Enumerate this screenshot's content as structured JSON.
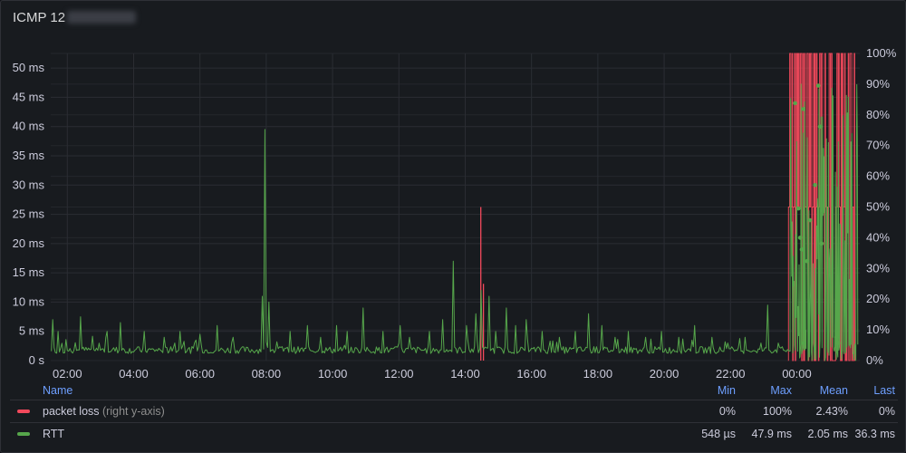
{
  "panel": {
    "title": "ICMP 12"
  },
  "chart_data": {
    "type": "line",
    "x_ticks": [
      "02:00",
      "04:00",
      "06:00",
      "08:00",
      "10:00",
      "12:00",
      "14:00",
      "16:00",
      "18:00",
      "20:00",
      "22:00",
      "00:00"
    ],
    "x_range_hours": [
      1.5,
      25.9
    ],
    "y_left": {
      "ticks": [
        "0 s",
        "5 ms",
        "10 ms",
        "15 ms",
        "20 ms",
        "25 ms",
        "30 ms",
        "35 ms",
        "40 ms",
        "45 ms",
        "50 ms"
      ],
      "ylim_ms": [
        0,
        52.5
      ]
    },
    "y_right": {
      "ticks": [
        "0%",
        "10%",
        "20%",
        "30%",
        "40%",
        "50%",
        "60%",
        "70%",
        "80%",
        "90%",
        "100%"
      ],
      "ylim_pct": [
        0,
        100
      ]
    },
    "grid": true,
    "series": [
      {
        "name": "packet loss",
        "axis": "right",
        "color": "#f2495c",
        "spikes_pct": [
          [
            14.47,
            50
          ],
          [
            14.55,
            25
          ]
        ],
        "dense_region_hours": [
          23.75,
          25.75
        ],
        "dense_levels_pct": [
          0,
          50,
          100
        ]
      },
      {
        "name": "RTT",
        "axis": "left",
        "color": "#56a64b",
        "baseline_ms": 1.2,
        "spikes_ms": [
          [
            1.55,
            7
          ],
          [
            1.72,
            5
          ],
          [
            2.4,
            7.5
          ],
          [
            3.2,
            5
          ],
          [
            3.6,
            6.5
          ],
          [
            4.3,
            5
          ],
          [
            4.9,
            4
          ],
          [
            5.4,
            5
          ],
          [
            6.0,
            4.5
          ],
          [
            6.5,
            6
          ],
          [
            7.0,
            4
          ],
          [
            7.85,
            11
          ],
          [
            7.95,
            39.5
          ],
          [
            8.05,
            10
          ],
          [
            8.7,
            5
          ],
          [
            9.2,
            6
          ],
          [
            9.6,
            4
          ],
          [
            10.1,
            6
          ],
          [
            10.4,
            5
          ],
          [
            10.9,
            9
          ],
          [
            11.5,
            5
          ],
          [
            12.0,
            6
          ],
          [
            12.3,
            4
          ],
          [
            12.9,
            5
          ],
          [
            13.3,
            7
          ],
          [
            13.6,
            17
          ],
          [
            14.0,
            6
          ],
          [
            14.3,
            8
          ],
          [
            14.45,
            12
          ],
          [
            14.7,
            11
          ],
          [
            14.9,
            5
          ],
          [
            15.2,
            9
          ],
          [
            15.5,
            6
          ],
          [
            15.8,
            7
          ],
          [
            16.3,
            5
          ],
          [
            16.8,
            4
          ],
          [
            17.3,
            5
          ],
          [
            17.7,
            8
          ],
          [
            18.1,
            6
          ],
          [
            18.5,
            4
          ],
          [
            18.9,
            5
          ],
          [
            19.4,
            4
          ],
          [
            19.9,
            5
          ],
          [
            20.4,
            4
          ],
          [
            20.9,
            6
          ],
          [
            21.4,
            4
          ],
          [
            21.9,
            3
          ],
          [
            22.4,
            4
          ],
          [
            22.9,
            3
          ],
          [
            23.1,
            9.5
          ],
          [
            23.4,
            3
          ]
        ],
        "dense_region_hours": [
          23.8,
          25.85
        ],
        "dense_max_ms": 47.9,
        "points_ms": [
          [
            23.95,
            44
          ],
          [
            24.05,
            26
          ],
          [
            24.1,
            21
          ],
          [
            24.15,
            19
          ],
          [
            24.2,
            43
          ],
          [
            24.3,
            17
          ],
          [
            24.4,
            24
          ],
          [
            24.55,
            30
          ],
          [
            24.65,
            47
          ],
          [
            24.7,
            40
          ],
          [
            24.75,
            20
          ],
          [
            25.2,
            4
          ],
          [
            25.25,
            3
          ],
          [
            24.2,
            3
          ]
        ]
      }
    ]
  },
  "legend": {
    "headers": {
      "name": "Name",
      "min": "Min",
      "max": "Max",
      "mean": "Mean",
      "last": "Last"
    },
    "rows": [
      {
        "name": "packet loss",
        "hint": "(right y-axis)",
        "color": "#f2495c",
        "min": "0%",
        "max": "100%",
        "mean": "2.43%",
        "last": "0%"
      },
      {
        "name": "RTT",
        "hint": "",
        "color": "#56a64b",
        "min": "548 µs",
        "max": "47.9 ms",
        "mean": "2.05 ms",
        "last": "36.3 ms"
      }
    ]
  }
}
